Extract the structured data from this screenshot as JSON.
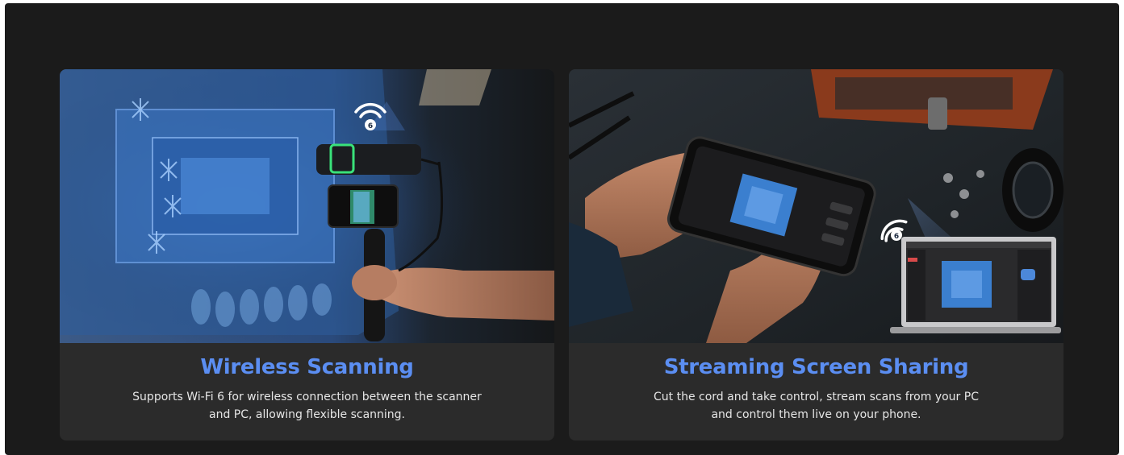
{
  "accent_color": "#5b8ef2",
  "cards": [
    {
      "title": "Wireless Scanning",
      "description": "Supports Wi-Fi 6 for wireless connection between the scanner and PC, allowing flexible scanning.",
      "image_icon": "wifi-6-icon"
    },
    {
      "title": "Streaming Screen Sharing",
      "description": "Cut the cord and take control, stream scans from your PC and control them live on your phone.",
      "image_icon": "wifi-6-icon"
    }
  ]
}
